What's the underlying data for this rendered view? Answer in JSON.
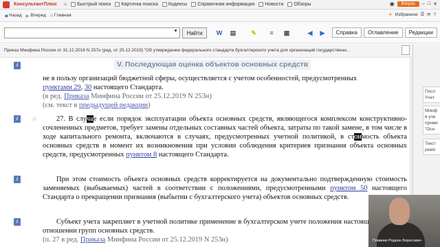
{
  "titlebar": {
    "app": "КонсультантПлюс",
    "items": [
      "Быстрый поиск",
      "Карточка поиска",
      "Кодексы",
      "Справочная информация",
      "Новости",
      "Обзоры"
    ],
    "favorites": "Избранное",
    "question": "Вопрос"
  },
  "navbar": {
    "back": "Назад",
    "forward": "Вперед",
    "home": "Главная"
  },
  "search": {
    "placeholder": "",
    "find_label": "Найти"
  },
  "panel_tabs": [
    "Справка",
    "Оглавление",
    "Редакции"
  ],
  "doc_header": "Приказ Минфина России от 31.12.2016 N 257н (ред. от 25.12.2019) \"Об утверждении федерального стандарта бухгалтерского учета для организаций государственн...",
  "section_title": "V. Последующая оценка объектов основных средств",
  "paragraphs": {
    "p1_line1": "не в пользу организаций бюджетной сферы, осуществляется с учетом особенностей, предусмотренных",
    "p1_link1": "пунктами 29",
    "p1_sep": ", ",
    "p1_link2": "30",
    "p1_tail": " настоящего Стандарта.",
    "p1_red_pre": "(в ред. ",
    "p1_red_link": "Приказа",
    "p1_red_post": " Минфина России от 25.12.2019 N 253н)",
    "p1_prev_pre": "(см. текст в ",
    "p1_prev_link": "предыдущей редакции",
    "p1_prev_post": ")",
    "p2_a": "27. В слу",
    "p2_hl1": "ча",
    "p2_b": "е если порядок эксплуатации объекта основных средств, являющегося комплексом конструктивно-сочлененных предметов, требует замены отдельных составных частей объекта, затраты по такой замене, в том числе в ходе капитального ремонта, включаются в случаях, предусмотренных учетной политикой, в ст",
    "p2_hl2": "ои",
    "p2_c": "мость объекта основных средств в момент их возникновения при условии соблюдения критериев признания объекта основных средств, предусмотренных ",
    "p2_link": "пунктом 8",
    "p2_d": " настоящего Стандарта.",
    "p3_a": "При этом стоимость объекта основных средств корректируется на документально подтвержденную стоимость заменяемых (выбываемых) частей в соответствии с положениями, предусмотренными ",
    "p3_link": "пунктом 50",
    "p3_b": " настоящего Стандарта о прекращении признания (выбытии с бухгалтерского учета) объектов основных средств.",
    "p4_a": "Субъект учета закрепляет в учетной политике применение в бухгалтерском учете положения настоящего пункта в отношении групп основных средств.",
    "p4_red_pre": "(п. 27 в ред. ",
    "p4_red_link": "Приказа",
    "p4_red_post": " Минфина России от 25.12.2019 N 253н)"
  },
  "right_panel": {
    "box1": [
      "Посл",
      "Учет"
    ],
    "box2": [
      "Минф",
      "в уче",
      "приме",
      "\"Осн"
    ],
    "box3": [
      "Текст",
      "ремо"
    ]
  },
  "webcam_caption": "Плавник Родион Борисович"
}
